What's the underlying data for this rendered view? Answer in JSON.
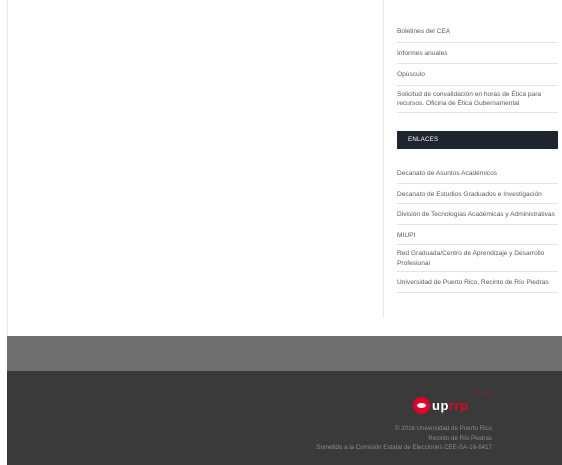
{
  "sidebar": {
    "links": [
      "Boletines del CEA",
      "Informes anuales",
      "Opúsculo",
      "Solicitud de convalidación en horas de Ética para recursos. Oficina de Ética Gubernamental"
    ],
    "section_header": "ENLACES",
    "enlaces": [
      "Decanato de Asuntos Académicos",
      "Decanato de Estudios Graduados e Investigación",
      "División de Tecnologías Académicas y Administrativas",
      "MIUPI",
      "Red Graduada/Centro de Aprendizaje y Desarrollo Profesional",
      "Universidad de Puerto Rico, Recinto de Río Piedras"
    ]
  },
  "footer": {
    "logo": {
      "text_white": "up",
      "text_red": "rrp",
      "tag": "LA IUPI"
    },
    "copyright": "© 2016 Universidad de Puerto Rico",
    "campus": "Recinto de Río Piedras",
    "notice": "Sometido a la Comisión Estatal de Elecciones CEE-SA-16-6417"
  },
  "colors": {
    "header_bg": "#1e252c",
    "footer_top": "#6f6f6f",
    "footer_bottom": "#3a3a3a",
    "brand_red": "#e4002b"
  }
}
